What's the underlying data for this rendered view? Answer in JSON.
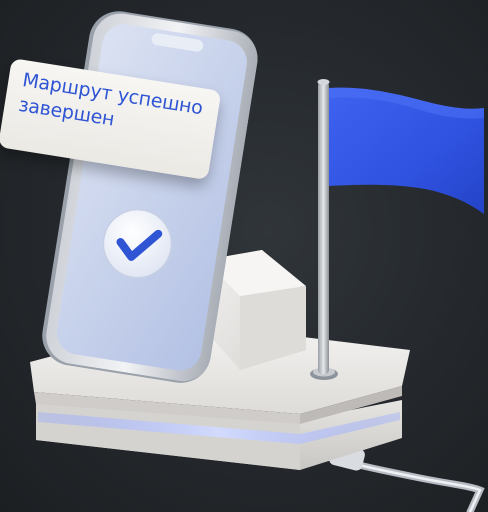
{
  "notification": {
    "message_line1": "Маршрут успешно",
    "message_line2": "завершен",
    "text_color": "#2f55d4"
  },
  "icons": {
    "check": "check-circle-icon",
    "flag": "flag-icon"
  },
  "colors": {
    "background": "#23272b",
    "flag": "#3558e6",
    "stand": "#eeeceb",
    "phone_screen": "#c9d4ec",
    "glow": "#b9c7ff"
  }
}
